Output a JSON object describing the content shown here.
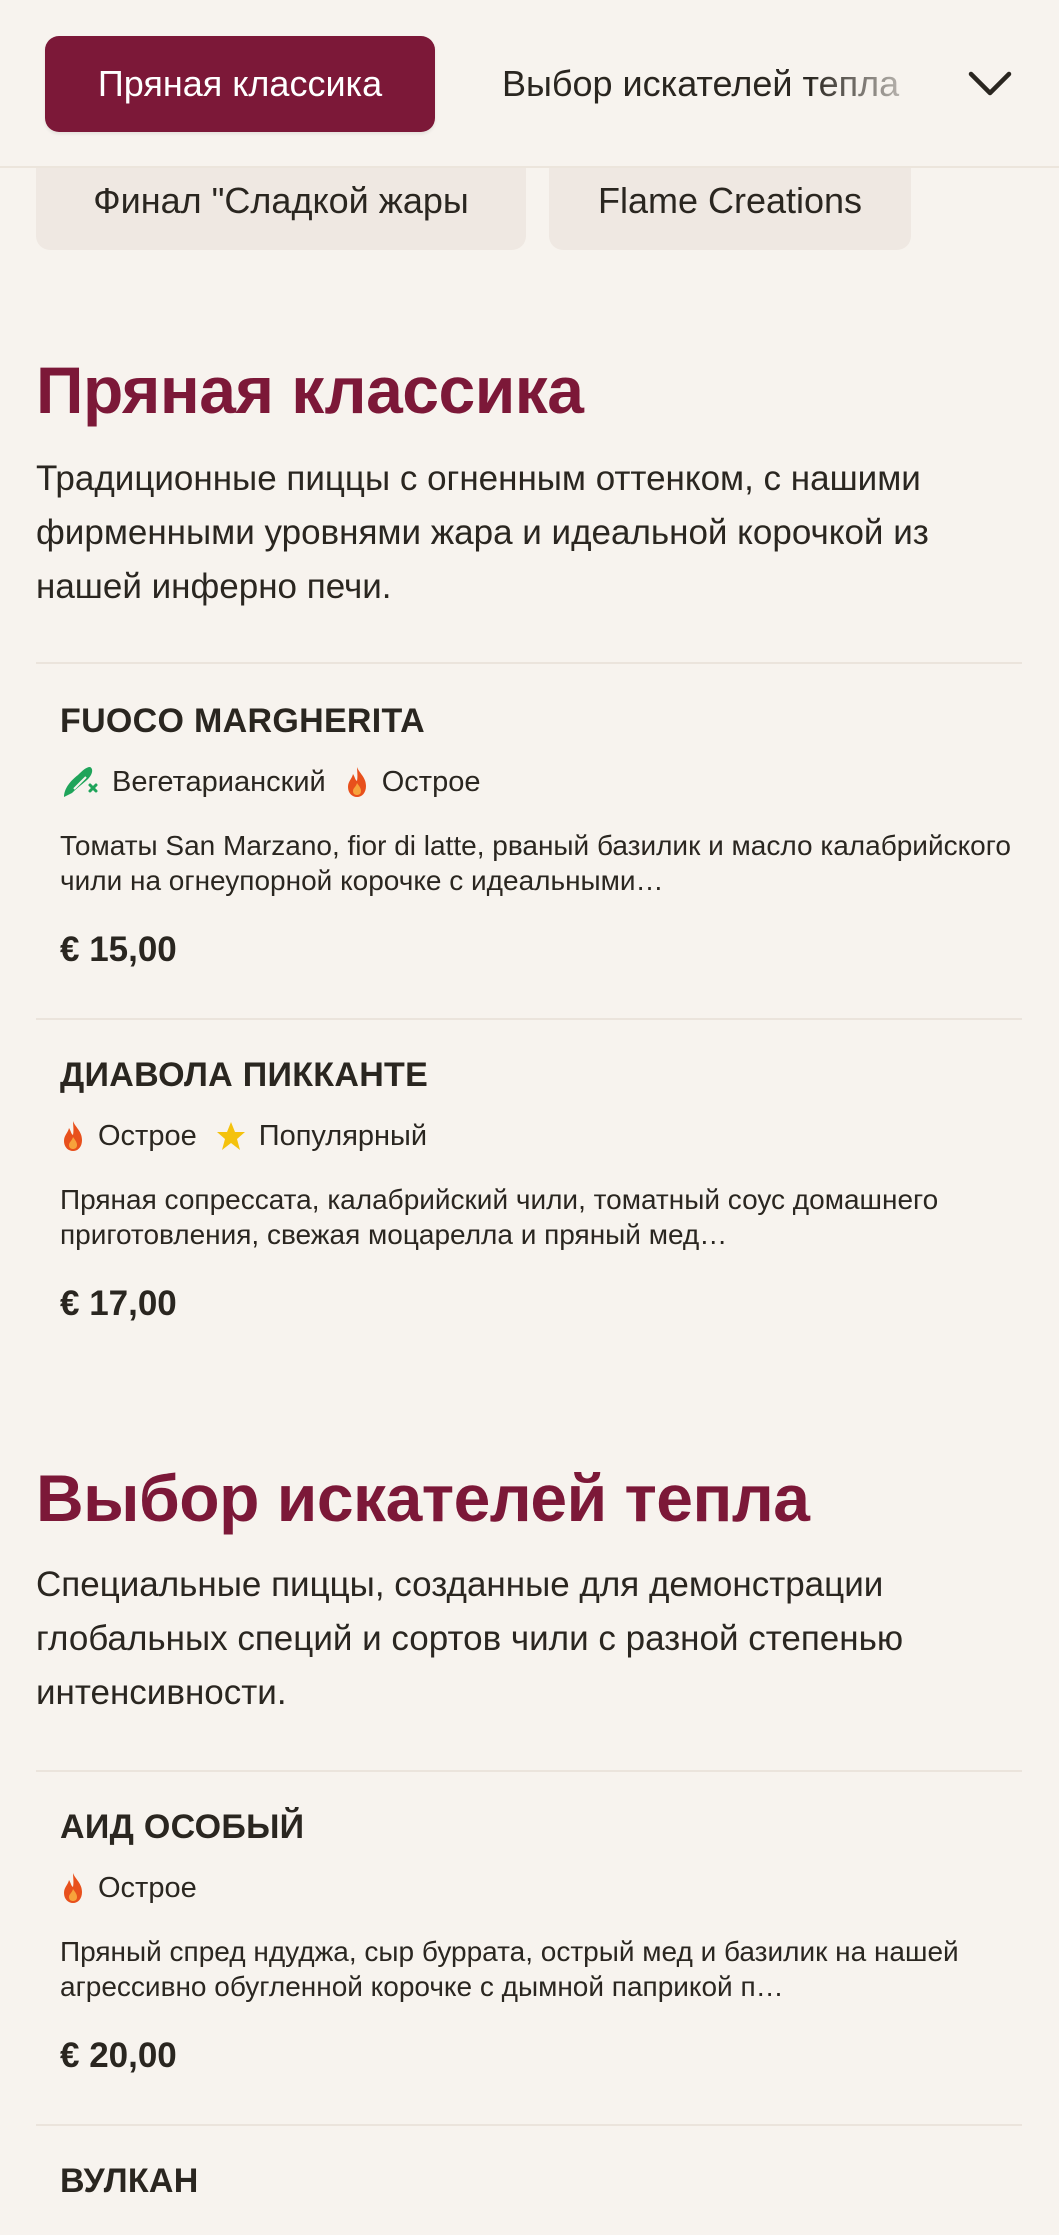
{
  "nav": {
    "active_tab": "Пряная классика",
    "next_tab": "Выбор искателей тепла",
    "expand_icon": "chevron-down-icon",
    "tabs": [
      "Финал \"Сладкой жары",
      "Flame Creations"
    ]
  },
  "colors": {
    "accent": "#7c1838",
    "background": "#f7f3ee",
    "tab_bg": "#efe8e2",
    "vegetarian": "#1fa45a",
    "spicy": "#e8501c",
    "popular": "#f4c20d"
  },
  "sections": [
    {
      "title": "Пряная классика",
      "description": "Традиционные пиццы с огненным оттенком, с нашими фирменными уровнями жара и идеальной корочкой из нашей инферно печи.",
      "items": [
        {
          "name": "FUOCO MARGHERITA",
          "tags": [
            {
              "icon": "vegetarian-icon",
              "label": "Вегетарианский"
            },
            {
              "icon": "flame-icon",
              "label": "Острое"
            }
          ],
          "description": "Томаты San Marzano, fior di latte, рваный базилик и масло калабрийского чили на огнеупорной корочке с идеальными…",
          "price": "€ 15,00"
        },
        {
          "name": "ДИАВОЛА ПИККАНТЕ",
          "tags": [
            {
              "icon": "flame-icon",
              "label": "Острое"
            },
            {
              "icon": "star-icon",
              "label": "Популярный"
            }
          ],
          "description": "Пряная сопрессата, калабрийский чили, томатный соус домашнего приготовления, свежая моцарелла и пряный мед…",
          "price": "€ 17,00"
        }
      ]
    },
    {
      "title": "Выбор искателей тепла",
      "description": "Специальные пиццы, созданные для демонстрации глобальных специй и сортов чили с разной степенью интенсивности.",
      "items": [
        {
          "name": "АИД ОСОБЫЙ",
          "tags": [
            {
              "icon": "flame-icon",
              "label": "Острое"
            }
          ],
          "description": "Пряный спред ндуджа, сыр буррата, острый мед и базилик на нашей агрессивно обугленной корочке с дымной паприкой п…",
          "price": "€ 20,00"
        },
        {
          "name": "ВУЛКАН",
          "tags": [],
          "description": "",
          "price": ""
        }
      ]
    }
  ]
}
